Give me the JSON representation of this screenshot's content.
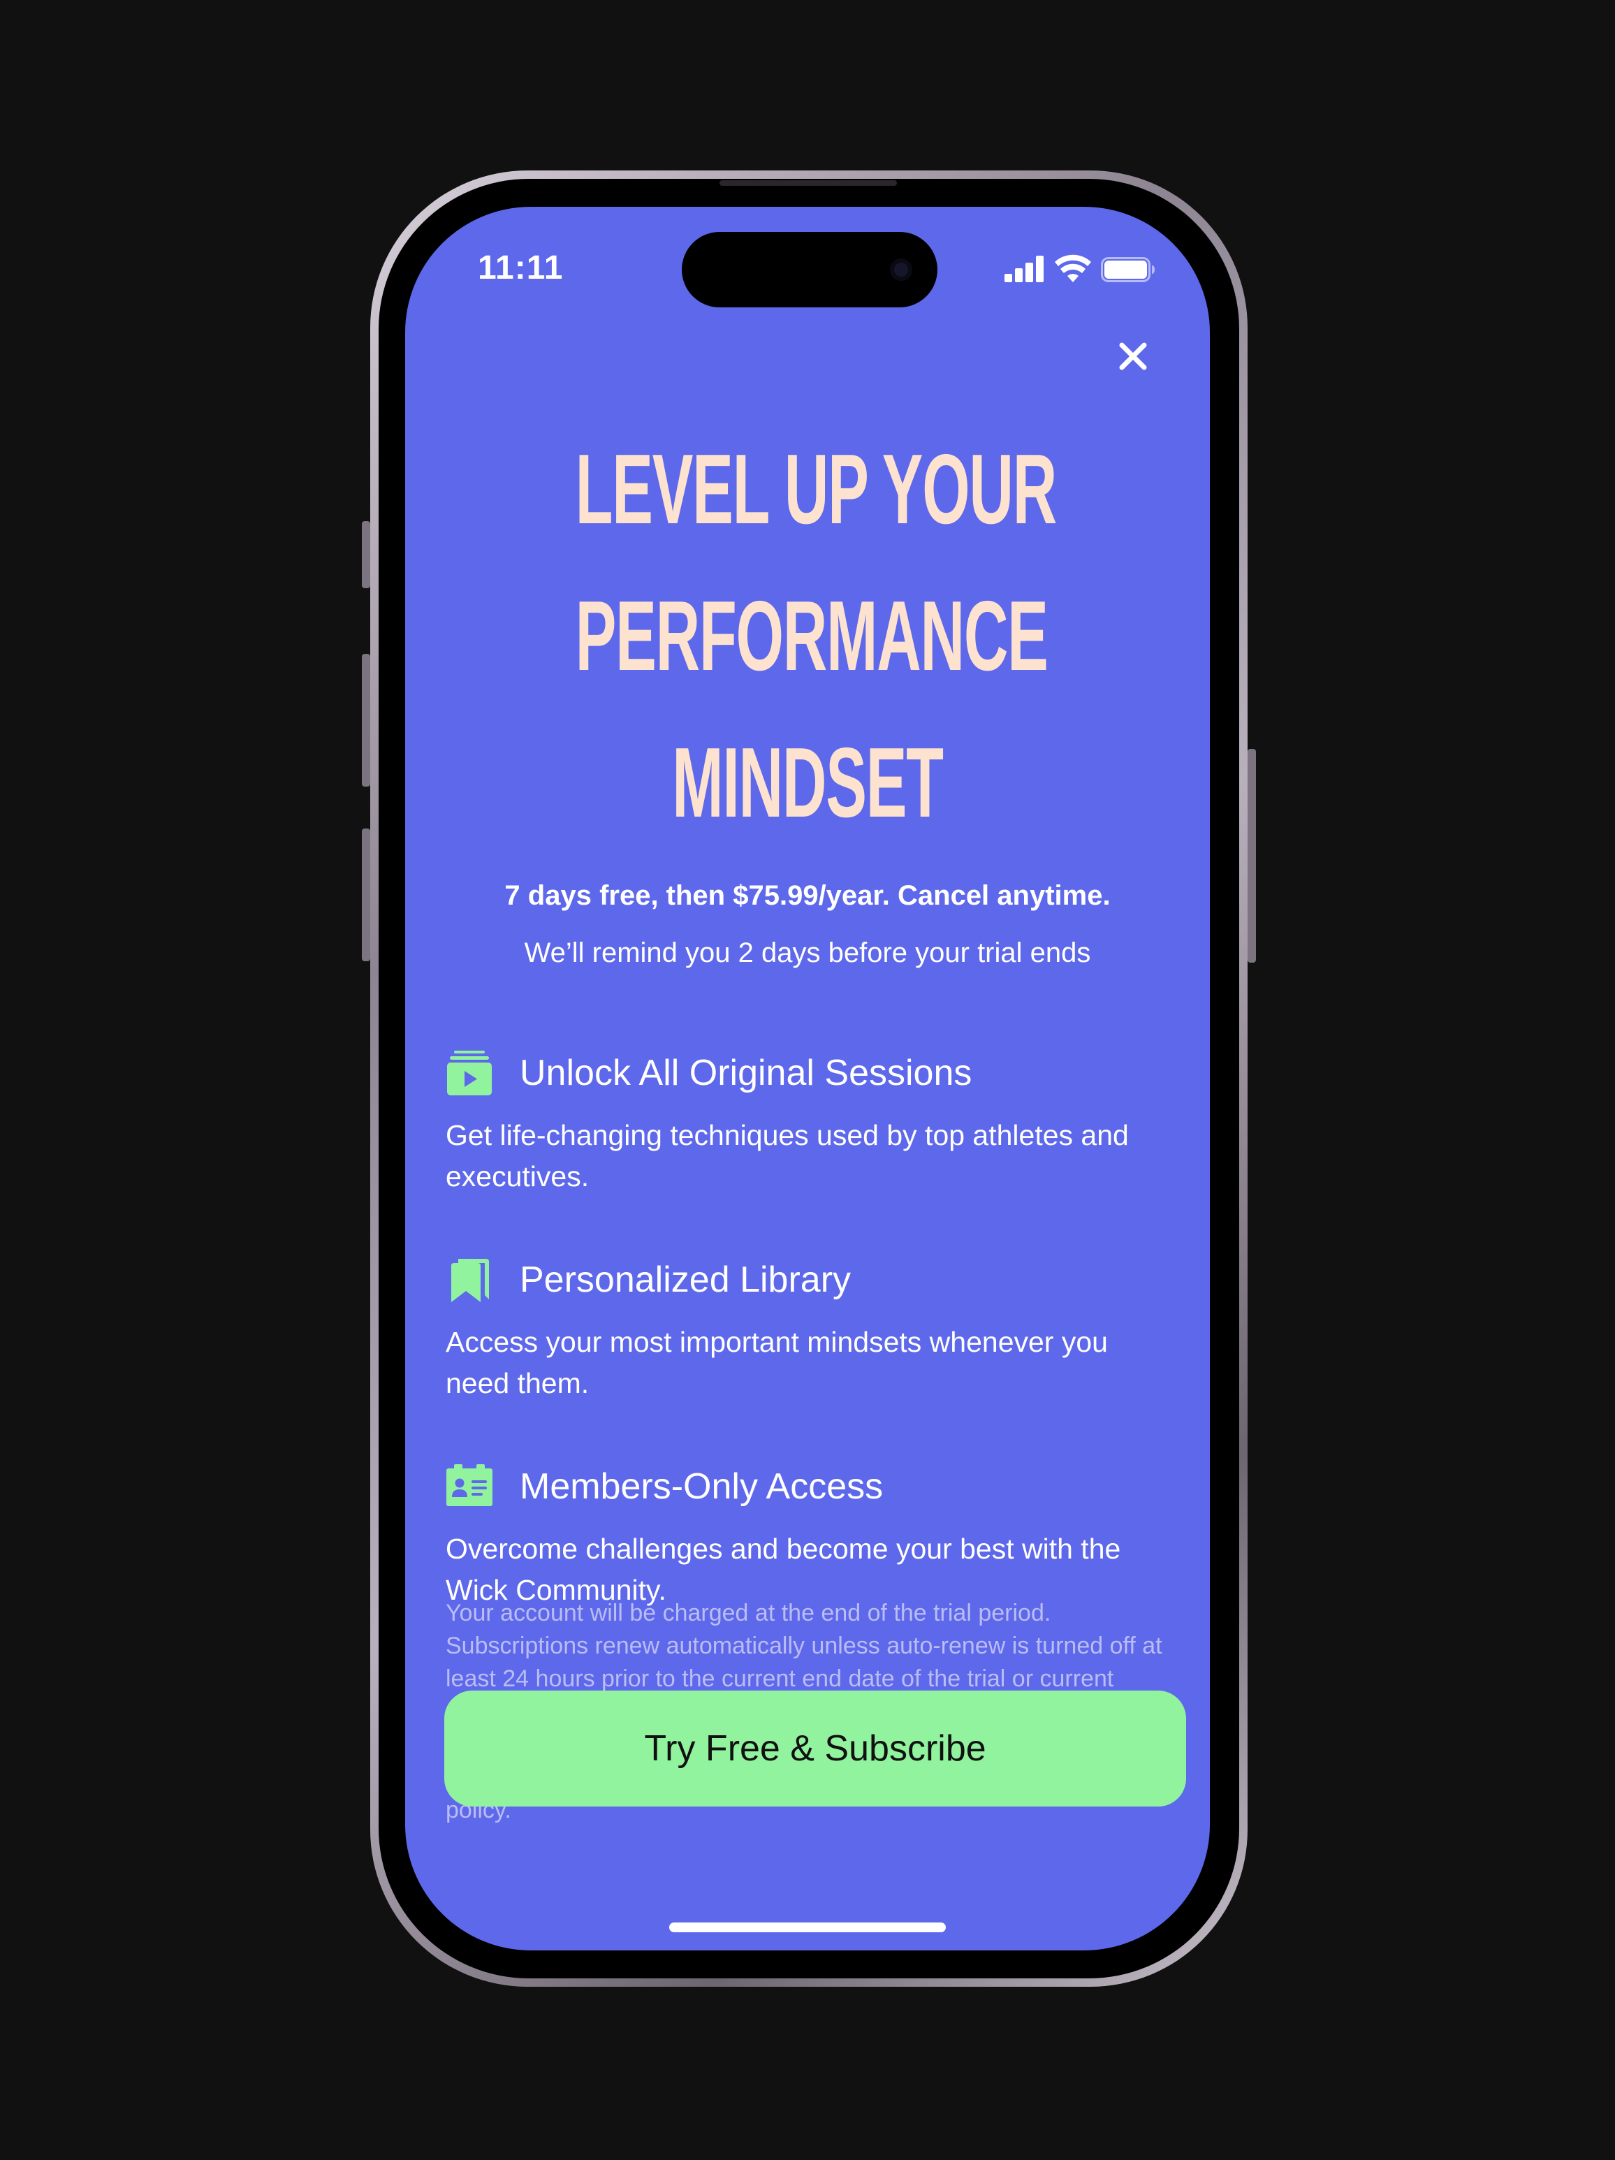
{
  "status_bar": {
    "time": "11:11"
  },
  "headline": {
    "line1": "LEVEL UP YOUR",
    "line2": "PERFORMANCE",
    "line3": "MINDSET"
  },
  "pricing": {
    "offer": "7 days free, then $75.99/year. Cancel anytime.",
    "reminder": "We’ll remind you 2 days before your trial ends"
  },
  "features": [
    {
      "icon": "play-stack-icon",
      "title": "Unlock All Original Sessions",
      "description": "Get life-changing techniques used by top athletes and executives."
    },
    {
      "icon": "bookmark-icon",
      "title": "Personalized Library",
      "description": "Access your most important mindsets whenever you need them."
    },
    {
      "icon": "member-card-icon",
      "title": "Members-Only Access",
      "description": "Overcome challenges and become your best with the Wick Community."
    }
  ],
  "legal_text": "Your account will be charged at the end of the trial period. Subscriptions renew automatically unless auto-renew is turned off at least 24 hours prior to the current end date of the trial or current period. You can manage your trial, manage your subscription, and turn off auto-renew in your Subscription Settings. Please review our Terms and Contitions to learn more and to find a link to our privacy policy.",
  "cta": {
    "label": "Try Free & Subscribe"
  },
  "colors": {
    "background": "#5e68eb",
    "headline": "#fde3cf",
    "accent_green": "#92f39e",
    "device_backdrop": "#111111"
  }
}
